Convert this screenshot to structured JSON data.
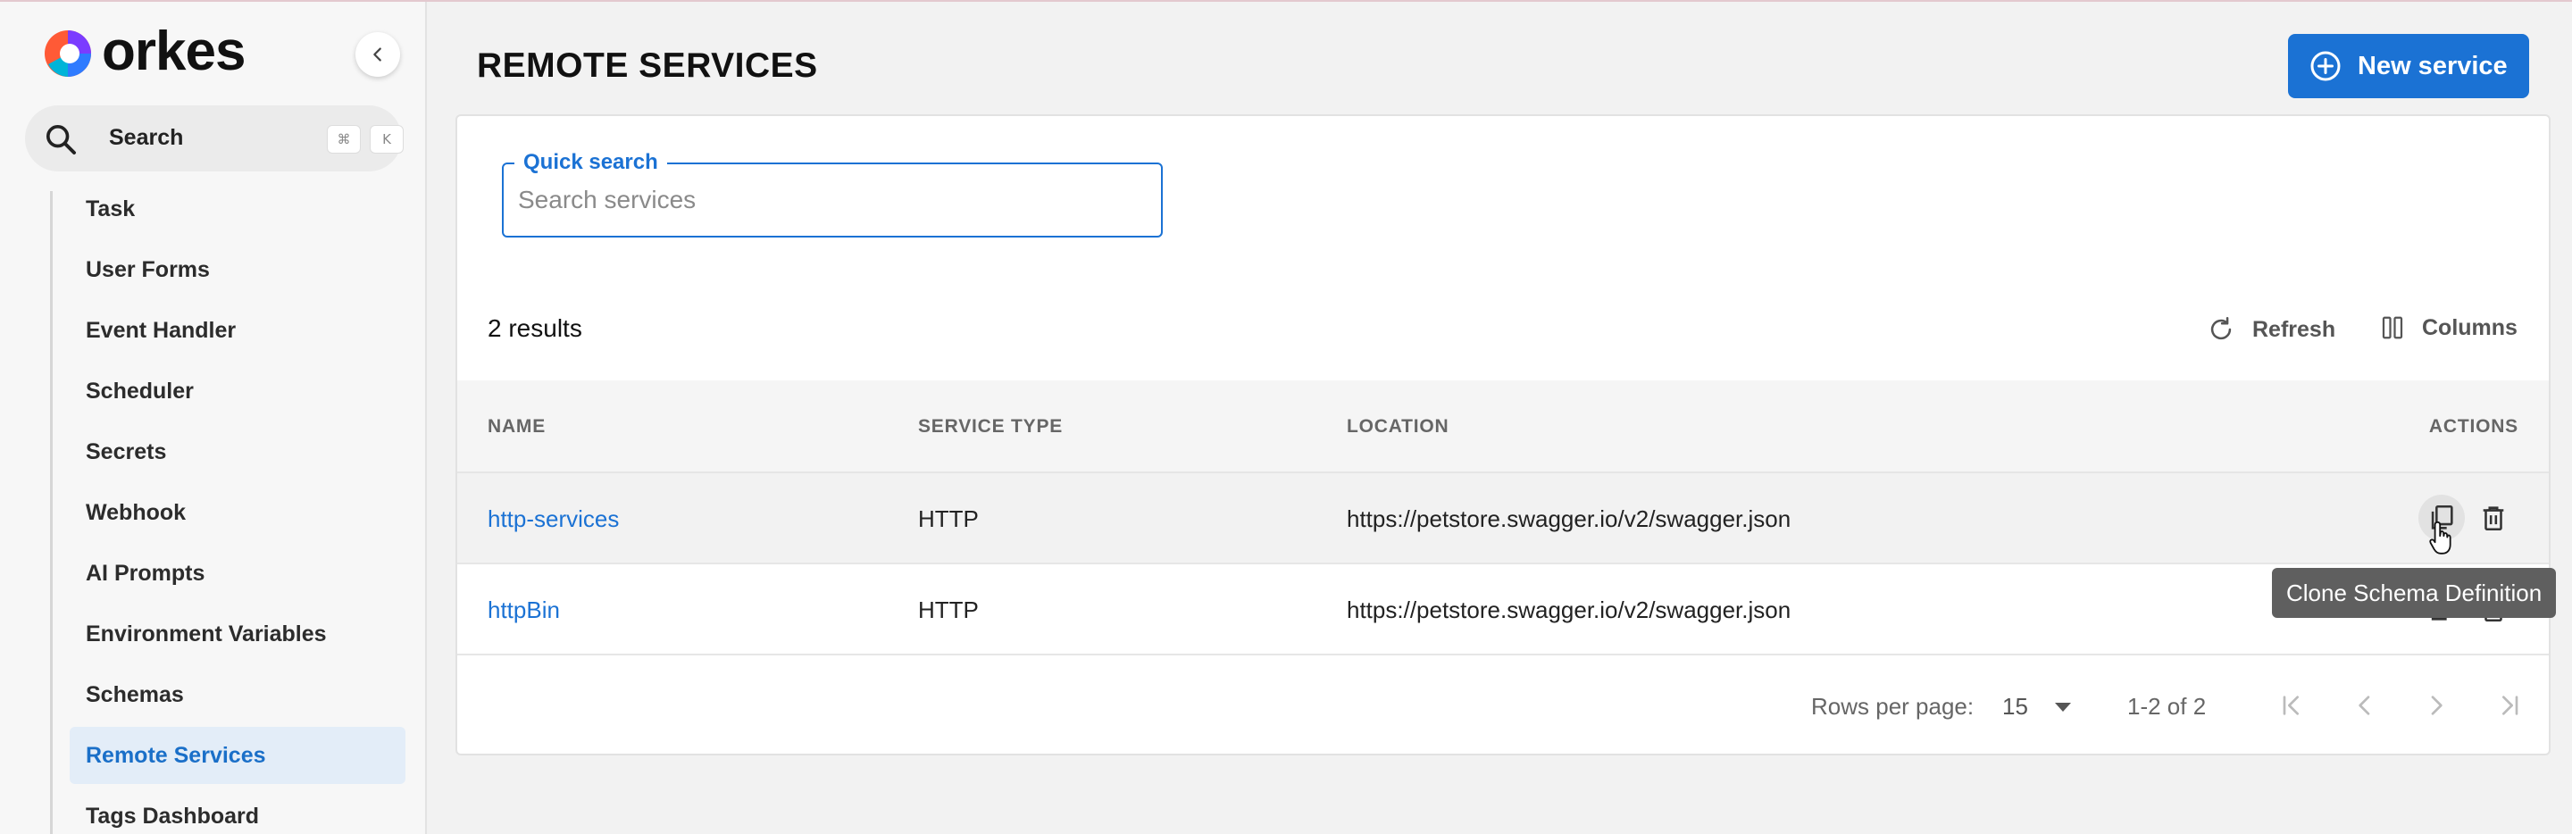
{
  "brand": {
    "name": "orkes"
  },
  "sidebar": {
    "search_label": "Search",
    "shortcut_keys": [
      "⌘",
      "K"
    ],
    "items": [
      {
        "label": "Task",
        "active": false
      },
      {
        "label": "User Forms",
        "active": false
      },
      {
        "label": "Event Handler",
        "active": false
      },
      {
        "label": "Scheduler",
        "active": false
      },
      {
        "label": "Secrets",
        "active": false
      },
      {
        "label": "Webhook",
        "active": false
      },
      {
        "label": "AI Prompts",
        "active": false
      },
      {
        "label": "Environment Variables",
        "active": false
      },
      {
        "label": "Schemas",
        "active": false
      },
      {
        "label": "Remote Services",
        "active": true
      },
      {
        "label": "Tags Dashboard",
        "active": false
      }
    ]
  },
  "header": {
    "title": "REMOTE SERVICES",
    "new_button_label": "New service"
  },
  "search": {
    "legend": "Quick search",
    "placeholder": "Search services",
    "value": ""
  },
  "toolbar": {
    "results": "2 results",
    "refresh_label": "Refresh",
    "columns_label": "Columns"
  },
  "table": {
    "columns": [
      "NAME",
      "SERVICE TYPE",
      "LOCATION",
      "ACTIONS"
    ],
    "rows": [
      {
        "name": "http-services",
        "type": "HTTP",
        "location": "https://petstore.swagger.io/v2/swagger.json"
      },
      {
        "name": "httpBin",
        "type": "HTTP",
        "location": "https://petstore.swagger.io/v2/swagger.json"
      }
    ]
  },
  "pagination": {
    "rows_per_page_label": "Rows per page:",
    "rows_per_page": "15",
    "range": "1-2 of 2"
  },
  "tooltip": {
    "text": "Clone Schema Definition"
  },
  "colors": {
    "accent": "#1b72d4",
    "active_nav_bg": "#e3edf8",
    "page_bg": "#f2f2f2"
  }
}
